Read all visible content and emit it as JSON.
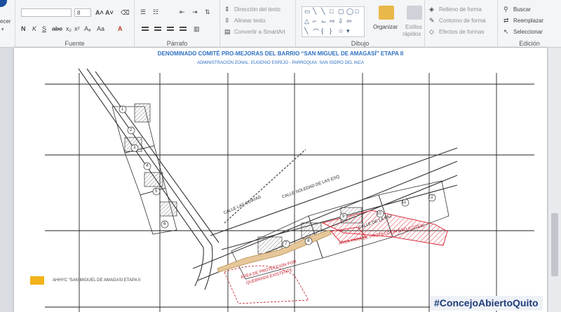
{
  "ribbon": {
    "clipboard": {
      "partial_label": "ecer"
    },
    "fuente": {
      "label": "Fuente",
      "font_size": "8",
      "grow_icon": "A˄",
      "shrink_icon": "A˅",
      "bold": "N",
      "italic": "K",
      "underline": "S",
      "strike": "abe",
      "sub": "x₂",
      "sup": "x²",
      "effects": "Aₐ",
      "case": "Aa",
      "color": "A"
    },
    "parrafo": {
      "label": "Párrafo"
    },
    "text_tools": {
      "direction": "Dirección del texto",
      "align": "Alinear texto",
      "smartart": "Convertir a SmartArt"
    },
    "dibujo": {
      "label": "Dibujo",
      "arrange": "Organizar",
      "styles_line1": "Estilos",
      "styles_line2": "rápidos"
    },
    "shape_format": {
      "fill": "Relleno de forma",
      "outline": "Contorno de forma",
      "effects": "Efectos de formas"
    },
    "edicion": {
      "label": "Edición",
      "search": "Buscar",
      "replace": "Reemplazar",
      "select": "Seleccionar"
    }
  },
  "document": {
    "title": "DENOMINADO COMITÉ PRO-MEJORAS DEL BARRIO “SAN MIGUEL DE AMAGASÍ” ETAPA II",
    "subtitle": "ADMINISTRACIÓN ZONAL: EUGENIO ESPEJO  -  PARROQUIA: SAN ISIDRO DEL INCA",
    "legend_label": "AHHYC “SAN MIGUEL DE AMAGASI ETAPA II",
    "map_labels": {
      "protection_area_1": "AREA PARA DE PROTECCION ESQ (LOTES)",
      "protection_area_2": "AREA DE PROTECCION POR",
      "protection_area_3": "QUEBRADA EXISTENTE",
      "street_1": "CALLE LAS GUAYAS",
      "street_2": "CALLE SOLEDAD DE LAS ESQ",
      "street_3": "CALLE DE LA PAZ",
      "lots": [
        "1",
        "2",
        "3",
        "4",
        "5",
        "6",
        "7",
        "8",
        "9",
        "10",
        "11",
        "12"
      ]
    }
  },
  "overlay": {
    "hashtag": "#ConcejoAbiertoQuito"
  },
  "colors": {
    "accent_blue": "#2e6fc2",
    "legend_yellow": "#f2b21b",
    "hatch_red": "#d9313f",
    "hashtag_text": "#1f3c7a"
  }
}
